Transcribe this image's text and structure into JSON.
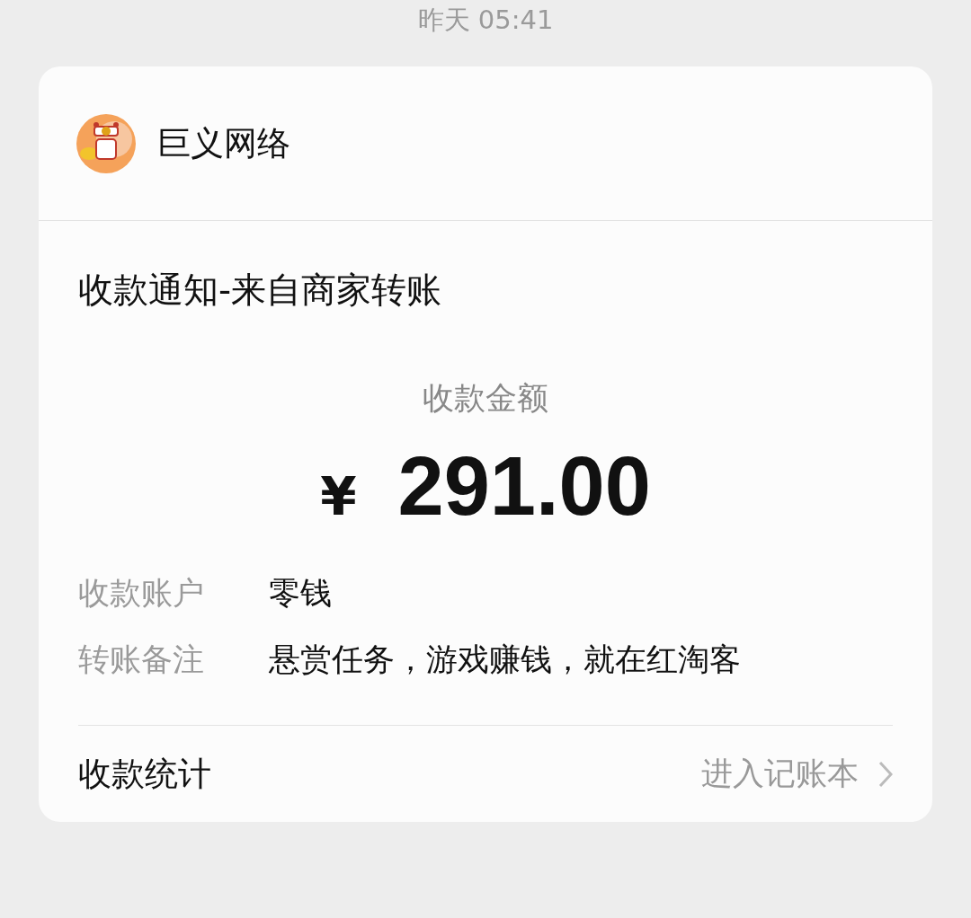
{
  "timestamp": "昨天 05:41",
  "card": {
    "sender": "巨义网络",
    "title": "收款通知-来自商家转账",
    "amount_label": "收款金额",
    "currency": "¥",
    "amount": "291.00",
    "details": [
      {
        "label": "收款账户",
        "value": "零钱"
      },
      {
        "label": "转账备注",
        "value": "悬赏任务，游戏赚钱，就在红淘客"
      }
    ],
    "footer": {
      "label": "收款统计",
      "link": "进入记账本"
    }
  }
}
